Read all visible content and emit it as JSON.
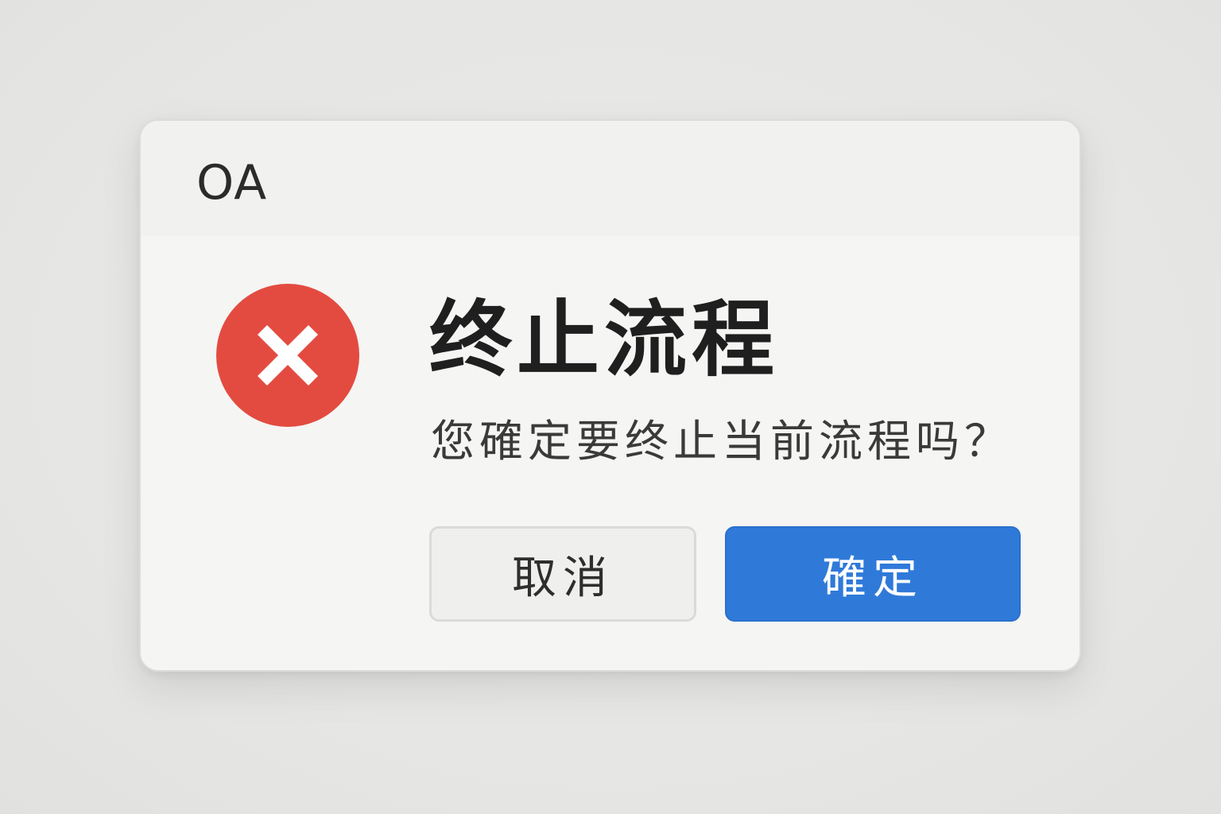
{
  "dialog": {
    "window_title": "OA",
    "icon": "error-x-circle-icon",
    "heading": "终止流程",
    "message": "您確定要终止当前流程吗？",
    "buttons": {
      "cancel_label": "取消",
      "confirm_label": "確定"
    }
  },
  "colors": {
    "error_red": "#e34b40",
    "primary_blue": "#2f7ad9",
    "dialog_background": "#f5f5f3",
    "page_background": "#e7e7e5"
  }
}
